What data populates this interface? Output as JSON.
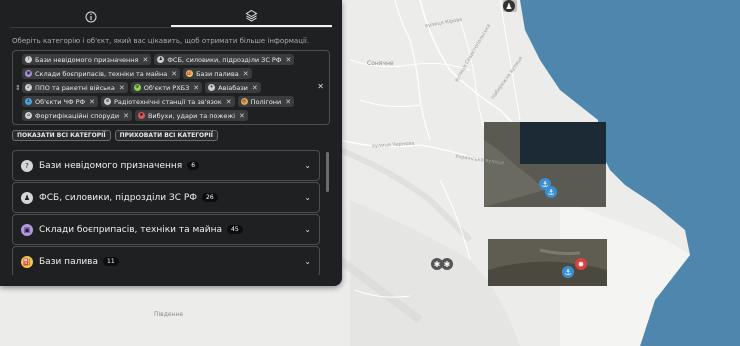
{
  "tabs": [
    {
      "name": "info",
      "icon": "info-icon",
      "active": false
    },
    {
      "name": "layers",
      "icon": "layers-icon",
      "active": true
    }
  ],
  "hint": "Оберіть категорію і об'єкт, який вас цікавить, щоб отримати більше інформації.",
  "tags": [
    {
      "label": "Бази невідомого призначення",
      "icon": "question-icon",
      "color": "#cfcfcf"
    },
    {
      "label": "ФСБ, силовики, підрозділи ЗС РФ",
      "icon": "soldier-icon",
      "color": "#cfcfcf"
    },
    {
      "label": "Склади боєприпасів, техніки та майна",
      "icon": "box-icon",
      "color": "#b197e6"
    },
    {
      "label": "Бази палива",
      "icon": "fuel-icon",
      "color": "#f2c94c"
    },
    {
      "label": "ППО та ракетні війська",
      "icon": "missile-icon",
      "color": "#cfcfcf"
    },
    {
      "label": "Об'єкти РХБЗ",
      "icon": "radiation-icon",
      "color": "#8fcf5a"
    },
    {
      "label": "Авіабази",
      "icon": "plane-icon",
      "color": "#cfcfcf"
    },
    {
      "label": "Об'єкти ЧФ РФ",
      "icon": "anchor-icon",
      "color": "#4aa3df"
    },
    {
      "label": "Радіотехнічні станції та зв'язок",
      "icon": "radar-icon",
      "color": "#cfcfcf"
    },
    {
      "label": "Полігони",
      "icon": "target-icon",
      "color": "#e6a35a"
    },
    {
      "label": "Фортифікаційні споруди",
      "icon": "bunker-icon",
      "color": "#cfcfcf"
    },
    {
      "label": "Вибухи, удари та пожежі",
      "icon": "explosion-icon",
      "color": "#e05555"
    }
  ],
  "buttons": {
    "show_all": "ПОКАЗАТИ ВСІ КАТЕГОРІЇ",
    "hide_all": "ПРИХОВАТИ ВСІ КАТЕГОРІЇ"
  },
  "categories": [
    {
      "name": "Бази невідомого призначення",
      "count": "6",
      "icon": "question-icon",
      "color": "#d6d6d6"
    },
    {
      "name": "ФСБ, силовики, підрозділи ЗС РФ",
      "count": "26",
      "icon": "soldier-icon",
      "color": "#d6d6d6"
    },
    {
      "name": "Склади боєприпасів, техніки та майна",
      "count": "45",
      "icon": "box-icon",
      "color": "#b197e6"
    },
    {
      "name": "Бази палива",
      "count": "11",
      "icon": "fuel-icon",
      "color": "#f2c94c"
    }
  ],
  "map": {
    "labels": {
      "sonyachne": "Сонячне",
      "pivdenne": "Південне",
      "street_chernova": "вулиця Чернова",
      "street_ukrainska": "Українська вулиця",
      "street_sevastopolska": "вулиця Севастопольська",
      "street_naberezhna": "Набережна вулиця",
      "street_kirova": "вулиця Кірова"
    },
    "colors": {
      "sea": "#4f86ad",
      "land": "#ececea",
      "satellite": "#5b5a52"
    }
  }
}
